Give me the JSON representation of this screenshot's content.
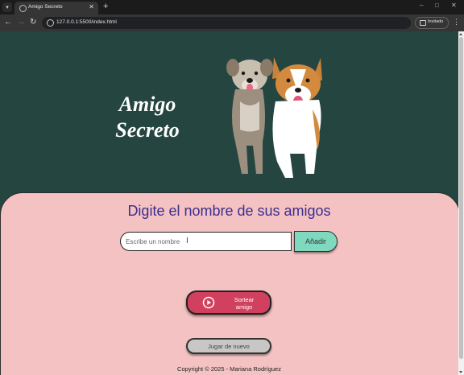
{
  "browser": {
    "tab_title": "Amigo Secreto",
    "new_tab_symbol": "+",
    "url": "127.0.0.1:5500/index.html",
    "profile_label": "Invitado"
  },
  "page": {
    "title_line1": "Amigo",
    "title_line2": "Secreto",
    "image_description_icon": "dogs-illustration",
    "heading": "Digite el nombre de sus amigos",
    "input_placeholder": "Escribe un nombre",
    "add_button": "Añadir",
    "draw_button_line1": "Sortear",
    "draw_button_line2": "amigo",
    "replay_button": "Jugar de nuevo",
    "copyright": "Copyright © 2025 - Mariana Rodríguez"
  },
  "colors": {
    "header_bg": "#244540",
    "panel_bg": "#f4c2c2",
    "heading_text": "#3b2e8f",
    "add_button_bg": "#7fd9bf",
    "draw_button_bg": "#d1405e",
    "replay_button_bg": "#c9c6c6"
  }
}
